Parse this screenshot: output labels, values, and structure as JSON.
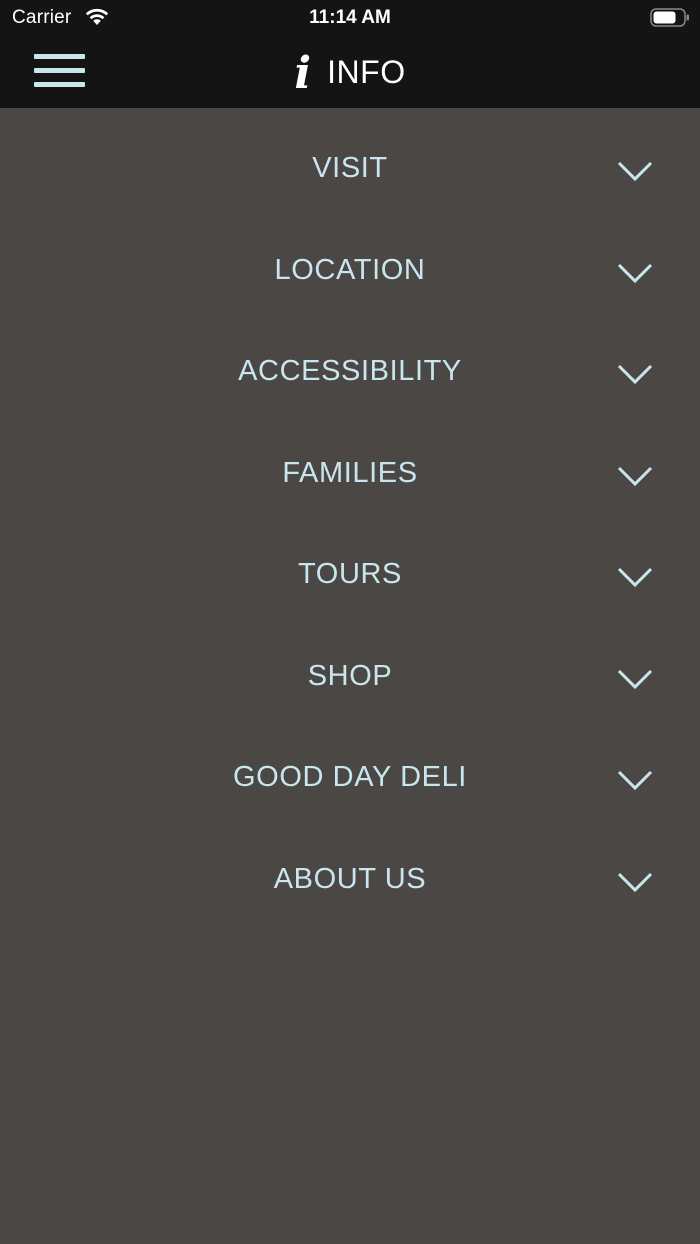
{
  "status_bar": {
    "carrier": "Carrier",
    "time": "11:14 AM"
  },
  "header": {
    "title": "INFO",
    "icon": "info-icon",
    "menu_icon": "hamburger-menu-icon"
  },
  "colors": {
    "background": "#4b4744",
    "header_background": "#141414",
    "accent": "#c9e6ef",
    "title_text": "#ffffff"
  },
  "menu": {
    "items": [
      {
        "label": "VISIT"
      },
      {
        "label": "LOCATION"
      },
      {
        "label": "ACCESSIBILITY"
      },
      {
        "label": "FAMILIES"
      },
      {
        "label": "TOURS"
      },
      {
        "label": "SHOP"
      },
      {
        "label": "GOOD DAY DELI"
      },
      {
        "label": "ABOUT US"
      }
    ]
  }
}
